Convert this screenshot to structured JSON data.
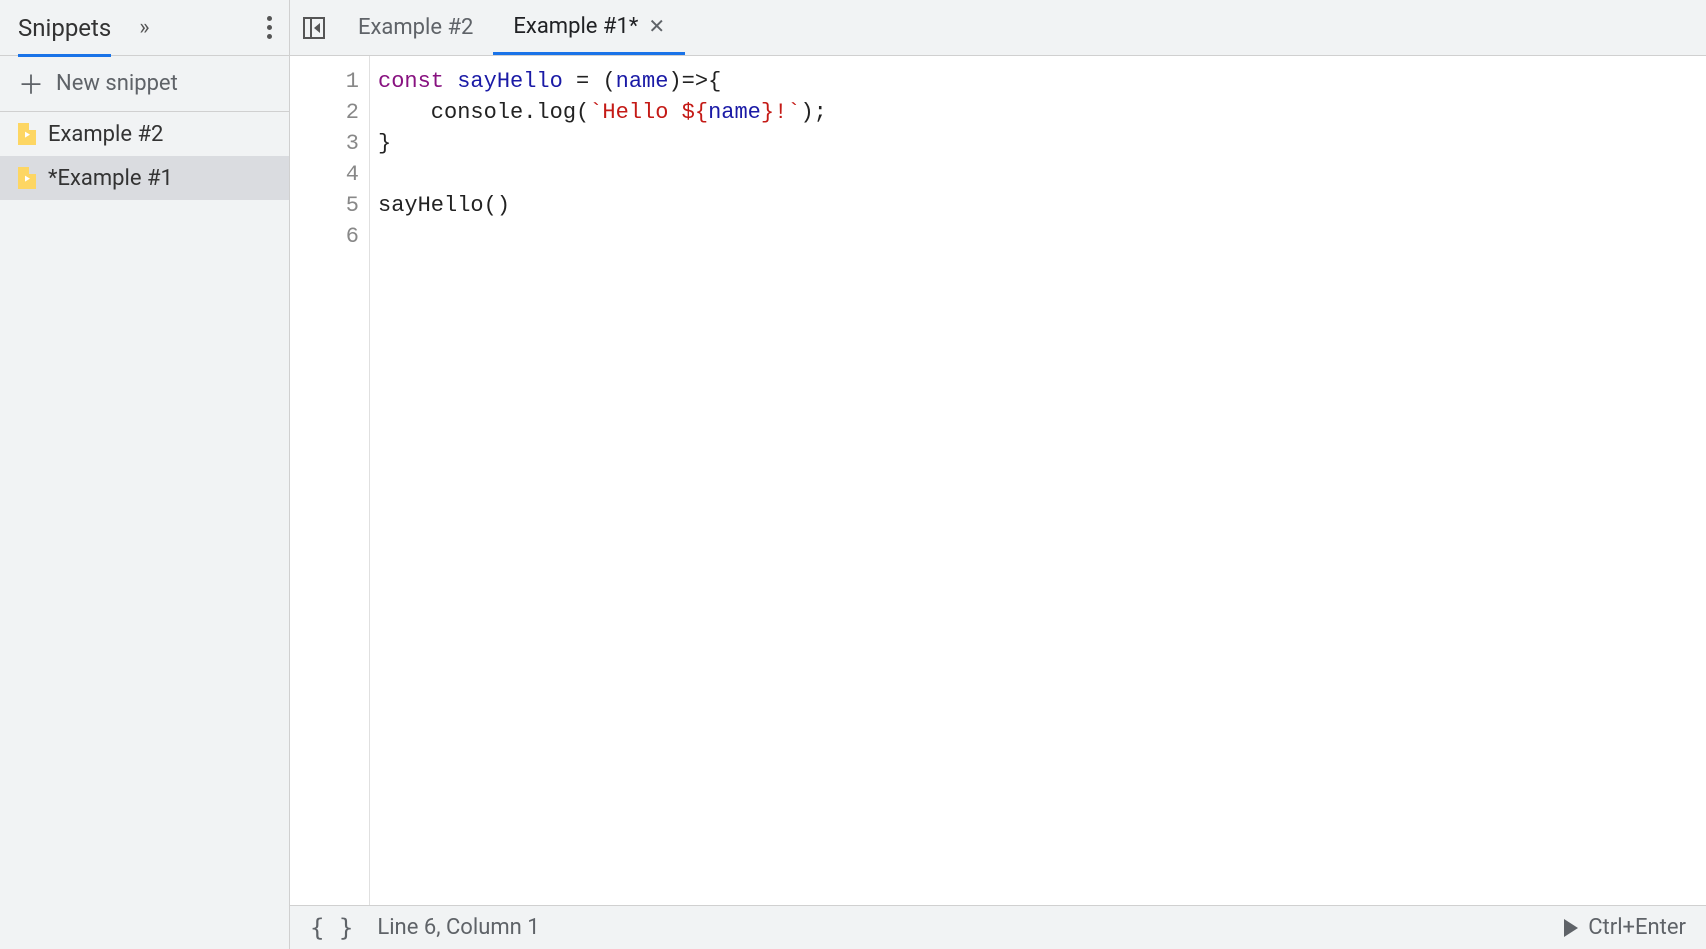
{
  "sidebar": {
    "title": "Snippets",
    "new_snippet_label": "New snippet",
    "items": [
      {
        "label": "Example #2",
        "selected": false
      },
      {
        "label": "*Example #1",
        "selected": true
      }
    ]
  },
  "tabs": [
    {
      "label": "Example #2",
      "active": false,
      "closable": false
    },
    {
      "label": "Example #1*",
      "active": true,
      "closable": true
    }
  ],
  "editor": {
    "line_numbers": [
      "1",
      "2",
      "3",
      "4",
      "5",
      "6"
    ],
    "code_tokens": [
      [
        {
          "t": "const ",
          "c": "kw"
        },
        {
          "t": "sayHello",
          "c": "var"
        },
        {
          "t": " = (",
          "c": "punct"
        },
        {
          "t": "name",
          "c": "var"
        },
        {
          "t": ")=>{",
          "c": "punct"
        }
      ],
      [
        {
          "t": "    console.log(",
          "c": "punct"
        },
        {
          "t": "`Hello ${",
          "c": "str"
        },
        {
          "t": "name",
          "c": "var"
        },
        {
          "t": "}!`",
          "c": "str"
        },
        {
          "t": ");",
          "c": "punct"
        }
      ],
      [
        {
          "t": "}",
          "c": "punct"
        }
      ],
      [
        {
          "t": "",
          "c": "punct"
        }
      ],
      [
        {
          "t": "sayHello()",
          "c": "punct"
        }
      ],
      [
        {
          "t": "",
          "c": "punct"
        }
      ]
    ]
  },
  "statusbar": {
    "position": "Line 6, Column 1",
    "run_hint": "Ctrl+Enter"
  }
}
